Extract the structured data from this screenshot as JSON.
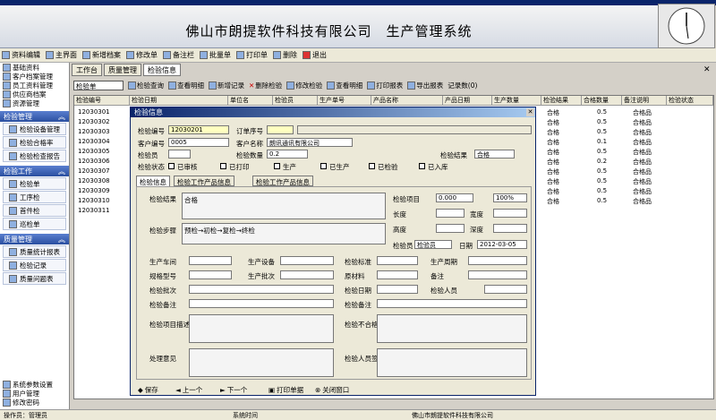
{
  "banner": {
    "title": "佛山市朗提软件科技有限公司　生产管理系统"
  },
  "menu": [
    "资料编辑",
    "主界面",
    "新增档案",
    "修改单",
    "备注栏",
    "批量单",
    "打印单",
    "删除",
    "退出"
  ],
  "sidebar": {
    "top_items": [
      "基础资料",
      "客户档案管理",
      "员工资料管理",
      "供应商档案",
      "资源管理"
    ],
    "group1": "检验管理",
    "group1_items": [
      "检验设备管理",
      "检验合格率",
      "检验检查报告"
    ],
    "group2": "检验工作",
    "group2_items": [
      "检验单",
      "工序检",
      "首件检",
      "巡检单"
    ],
    "group3": "质量管理",
    "group3_items": [
      "质量统计报表",
      "检验记录",
      "质量问题表"
    ],
    "bottom_items": [
      "系统参数设置",
      "用户管理",
      "修改密码"
    ]
  },
  "tabs": [
    "工作台",
    "质量管理",
    "检验信息"
  ],
  "toolbar": {
    "combo": "检验单",
    "items": [
      "检验查询",
      "查看明细",
      "新增记录",
      "删除检验",
      "修改检验",
      "查看明细",
      "打印报表",
      "导出报表",
      "记录数(0)"
    ]
  },
  "grid": {
    "headers": [
      "检验编号",
      "检验日期",
      "单位名",
      "检验员",
      "生产单号",
      "产品名称",
      "产品日期",
      "生产数量",
      "检验结果",
      "合格数量",
      "备注说明",
      "检验状态"
    ],
    "ids": [
      "12030301",
      "12030302",
      "12030303",
      "12030304",
      "12030305",
      "12030306",
      "12030307",
      "12030308",
      "12030309",
      "12030310",
      "12030311"
    ],
    "right": [
      [
        "合格",
        "0.5",
        "合格品"
      ],
      [
        "合格",
        "0.5",
        "合格品"
      ],
      [
        "合格",
        "0.5",
        "合格品"
      ],
      [
        "合格",
        "0.1",
        "合格品"
      ],
      [
        "合格",
        "0.5",
        "合格品"
      ],
      [
        "合格",
        "0.2",
        "合格品"
      ],
      [
        "合格",
        "0.5",
        "合格品"
      ],
      [
        "合格",
        "0.5",
        "合格品"
      ],
      [
        "合格",
        "0.5",
        "合格品"
      ],
      [
        "合格",
        "0.5",
        "合格品"
      ]
    ]
  },
  "dialog": {
    "title": "检验信息",
    "fields": {
      "no_label": "检验编号",
      "no_value": "12030201",
      "order_label": "订单序号",
      "order_value": "",
      "company_label": "客户编号",
      "company_value": "0005",
      "cust_label": "客户名称",
      "cust_value": "朗讯通讯有限公司",
      "insp_label": "检验员",
      "insp_value": "",
      "qty_label": "检验数量",
      "qty_value": "0.2",
      "result_label": "检验结果",
      "result_value": "合格"
    },
    "checks": [
      "检验状态",
      "已审核",
      "已打印",
      "生产",
      "已生产",
      "已检验",
      "已入库"
    ],
    "dtabs": [
      "检验信息",
      "检验工作产品信息",
      "检验工作产品信息"
    ],
    "section": {
      "type_label": "检验结果",
      "type_value": "合格",
      "proc_label": "检验步骤",
      "proc_value": "预检→初检→复检→终检",
      "r1": [
        "检验项目",
        "0.000",
        "100%"
      ],
      "r2": [
        "长度",
        "宽度"
      ],
      "r3": [
        "高度",
        "深度"
      ],
      "r4": [
        "检验员",
        "检验员",
        "日期",
        "2012-03-05"
      ]
    },
    "row_labels": [
      "生产车间",
      "生产设备",
      "检验标准",
      "生产周期",
      "规格型号",
      "生产批次",
      "原材料",
      "备注",
      "检验批次",
      "检验日期",
      "检验人员",
      "检验备注"
    ],
    "big_labels": [
      "检验项目描述",
      "检验不合格原因",
      "处理意见",
      "检验人员签名"
    ],
    "buttons": [
      "保存",
      "上一个",
      "下一个",
      "打印单据",
      "关闭窗口"
    ]
  },
  "status": [
    "操作员：管理员",
    "系统时间",
    "佛山市朗提软件科技有限公司"
  ]
}
